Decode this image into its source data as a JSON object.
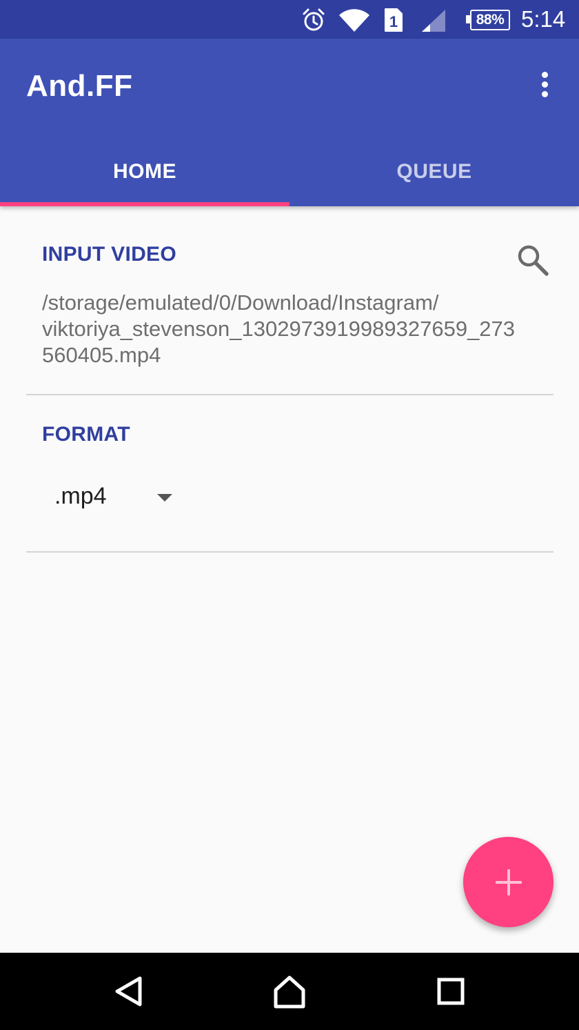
{
  "status_bar": {
    "battery": "88%",
    "sim_label": "1",
    "time": "5:14",
    "icons": [
      "alarm-icon",
      "wifi-icon",
      "sim-icon",
      "signal-icon",
      "battery-icon"
    ]
  },
  "app_bar": {
    "title": "And.FF",
    "menu_icon": "overflow-menu-icon"
  },
  "tabs": [
    {
      "label": "HOME",
      "selected": true
    },
    {
      "label": "QUEUE",
      "selected": false
    }
  ],
  "input_video": {
    "label": "INPUT VIDEO",
    "path_lines": [
      "/storage/emulated/0/Download/Instagram/",
      "viktoriya_stevenson_130297391998932765​9_273",
      "560405.mp4"
    ],
    "search_icon": "search-icon"
  },
  "format": {
    "label": "FORMAT",
    "selected": ".mp4"
  },
  "fab": {
    "icon": "plus-icon"
  },
  "nav_bar": {
    "icons": [
      "back-icon",
      "home-icon",
      "recents-icon"
    ]
  },
  "colors": {
    "status_bar": "#303f9f",
    "app_bar": "#3f51b5",
    "accent": "#ff4081",
    "section_label": "#303f9f"
  }
}
